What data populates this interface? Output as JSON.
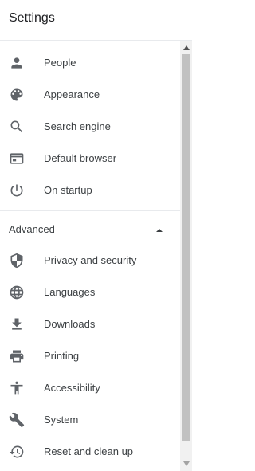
{
  "header": {
    "title": "Settings"
  },
  "menu": {
    "items": [
      {
        "label": "People",
        "icon": "person-icon"
      },
      {
        "label": "Appearance",
        "icon": "palette-icon"
      },
      {
        "label": "Search engine",
        "icon": "search-icon"
      },
      {
        "label": "Default browser",
        "icon": "browser-window-icon"
      },
      {
        "label": "On startup",
        "icon": "power-icon"
      }
    ],
    "advanced": {
      "label": "Advanced",
      "expanded": true,
      "icon": "arrow-up-icon",
      "items": [
        {
          "label": "Privacy and security",
          "icon": "shield-icon"
        },
        {
          "label": "Languages",
          "icon": "globe-icon"
        },
        {
          "label": "Downloads",
          "icon": "download-icon"
        },
        {
          "label": "Printing",
          "icon": "printer-icon"
        },
        {
          "label": "Accessibility",
          "icon": "accessibility-icon"
        },
        {
          "label": "System",
          "icon": "wrench-icon"
        },
        {
          "label": "Reset and clean up",
          "icon": "history-icon"
        }
      ]
    }
  },
  "colors": {
    "icon": "#5f6368",
    "text": "#3c4043",
    "divider": "#e8eaed",
    "scroll_track": "#f1f1f1",
    "scroll_thumb": "#c1c1c1"
  }
}
